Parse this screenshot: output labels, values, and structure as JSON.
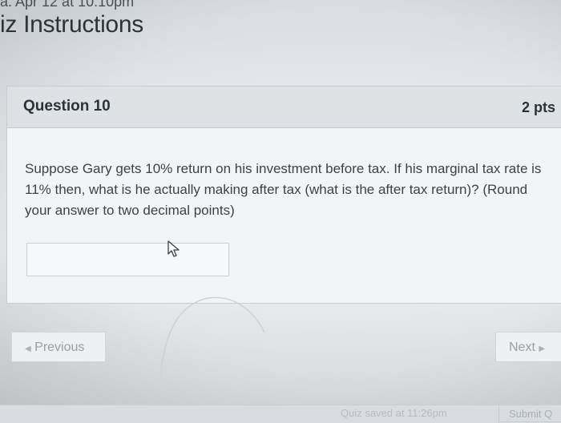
{
  "header": {
    "cut_text": "a. Apr 12 at 10:10pm",
    "title": "iz Instructions"
  },
  "question": {
    "number_label": "Question 10",
    "points_label": "2 pts",
    "text": "Suppose Gary gets 10% return on his investment before tax. If his marginal tax rate is 11% then, what is he actually making after tax (what is the after tax return)? (Round your answer to two decimal points)",
    "answer_value": ""
  },
  "navigation": {
    "previous_label": "Previous",
    "next_label": "Next"
  },
  "footer": {
    "saved_text": "Quiz saved at 11:26pm",
    "submit_label": "Submit Q"
  },
  "icons": {
    "prev_arrow": "triangle-left",
    "next_arrow": "triangle-right",
    "cursor": "mouse-pointer-arrow"
  }
}
